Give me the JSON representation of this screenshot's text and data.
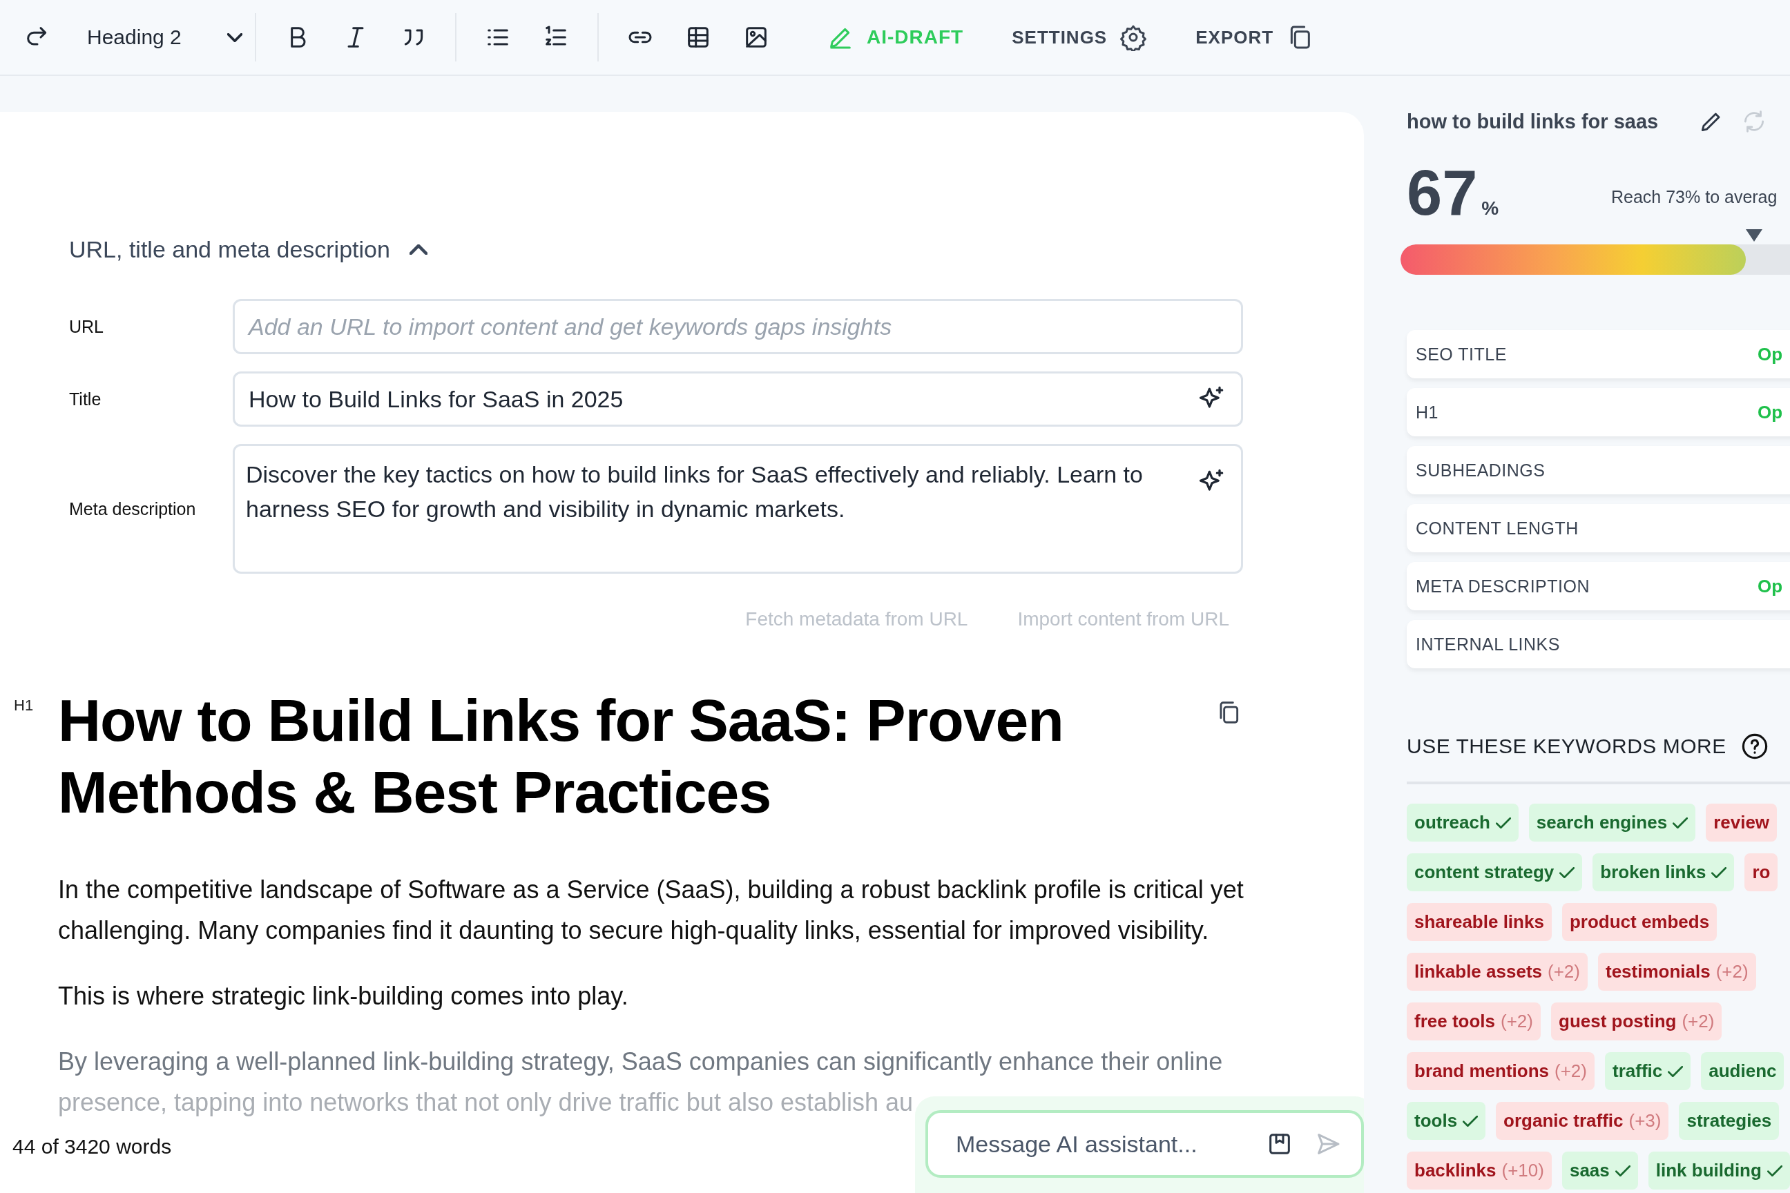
{
  "toolbar": {
    "block_style": "Heading 2",
    "actions": [
      {
        "label": "AI-DRAFT",
        "selected": true
      },
      {
        "label": "SETTINGS",
        "selected": false
      },
      {
        "label": "EXPORT",
        "selected": false
      }
    ]
  },
  "meta_section": {
    "title": "URL, title and meta description",
    "expanded": true,
    "fields": [
      {
        "label": "URL",
        "kind": "input",
        "placeholder": "Add an URL to import content and get keywords gaps insights",
        "ai_assist": false
      },
      {
        "label": "Title",
        "kind": "input",
        "value": "How to Build Links for SaaS in 2025",
        "ai_assist": true
      },
      {
        "label": "Meta description",
        "kind": "textarea",
        "value": "Discover the key tactics on how to build links for SaaS effectively and reliably. Learn to harness SEO for growth and visibility in dynamic markets.",
        "ai_assist": true
      }
    ],
    "links": [
      "Fetch metadata from URL",
      "Import content from URL"
    ]
  },
  "document": {
    "heading_tag": "H1",
    "heading": "How to Build Links for SaaS: Proven Methods & Best Practices",
    "paragraphs": [
      {
        "text": "In the competitive landscape of Software as a Service (SaaS), building a robust backlink profile is critical yet challenging. Many companies find it daunting to secure high-quality links, essential for improved visibility.",
        "faded": false
      },
      {
        "text": "This is where strategic link-building comes into play.",
        "faded": false
      },
      {
        "text": "By leveraging a well-planned link-building strategy, SaaS companies can significantly enhance their online presence, tapping into networks that not only drive traffic but also establish au",
        "faded": true
      }
    ]
  },
  "word_count": "44 of 3420 words",
  "chat": {
    "placeholder": "Message AI assistant..."
  },
  "panel": {
    "keyword": "how to build links for saas",
    "score": "67",
    "score_unit": "%",
    "target_text": "Reach 73% to averag",
    "level": 0.67,
    "checks": [
      {
        "label": "SEO TITLE",
        "status": "Op"
      },
      {
        "label": "H1",
        "status": "Op"
      },
      {
        "label": "SUBHEADINGS"
      },
      {
        "label": "CONTENT LENGTH"
      },
      {
        "label": "META DESCRIPTION",
        "status": "Op"
      },
      {
        "label": "INTERNAL LINKS"
      }
    ],
    "keywords_title": "USE THESE KEYWORDS MORE",
    "keyword_rows": [
      [
        {
          "text": "outreach",
          "kind": "used",
          "checked": true
        },
        {
          "text": "search engines",
          "kind": "used",
          "checked": true
        },
        {
          "text": "review",
          "kind": "missing",
          "checked": false
        }
      ],
      [
        {
          "text": "content strategy",
          "kind": "used",
          "checked": true
        },
        {
          "text": "broken links",
          "kind": "used",
          "checked": true
        },
        {
          "text": "ro",
          "kind": "missing",
          "checked": false
        }
      ],
      [
        {
          "text": "shareable links",
          "kind": "missing",
          "checked": false
        },
        {
          "text": "product embeds",
          "kind": "missing",
          "checked": false
        }
      ],
      [
        {
          "text": "linkable assets",
          "kind": "missing",
          "count": "(+2)",
          "checked": false
        },
        {
          "text": "testimonials",
          "kind": "missing",
          "count": "(+2)",
          "checked": false
        }
      ],
      [
        {
          "text": "free tools",
          "kind": "missing",
          "count": "(+2)",
          "checked": false
        },
        {
          "text": "guest posting",
          "kind": "missing",
          "count": "(+2)",
          "checked": false
        }
      ],
      [
        {
          "text": "brand mentions",
          "kind": "missing",
          "count": "(+2)",
          "checked": false
        },
        {
          "text": "traffic",
          "kind": "used",
          "checked": true
        },
        {
          "text": "audienc",
          "kind": "used",
          "checked": false
        }
      ],
      [
        {
          "text": "tools",
          "kind": "used",
          "checked": true
        },
        {
          "text": "organic traffic",
          "kind": "missing",
          "count": "(+3)",
          "checked": false
        },
        {
          "text": "strategies",
          "kind": "used",
          "checked": false
        }
      ],
      [
        {
          "text": "backlinks",
          "kind": "missing",
          "count": "(+10)",
          "checked": false
        },
        {
          "text": "saas",
          "kind": "used",
          "checked": true
        },
        {
          "text": "link building",
          "kind": "used",
          "checked": true
        }
      ]
    ]
  }
}
